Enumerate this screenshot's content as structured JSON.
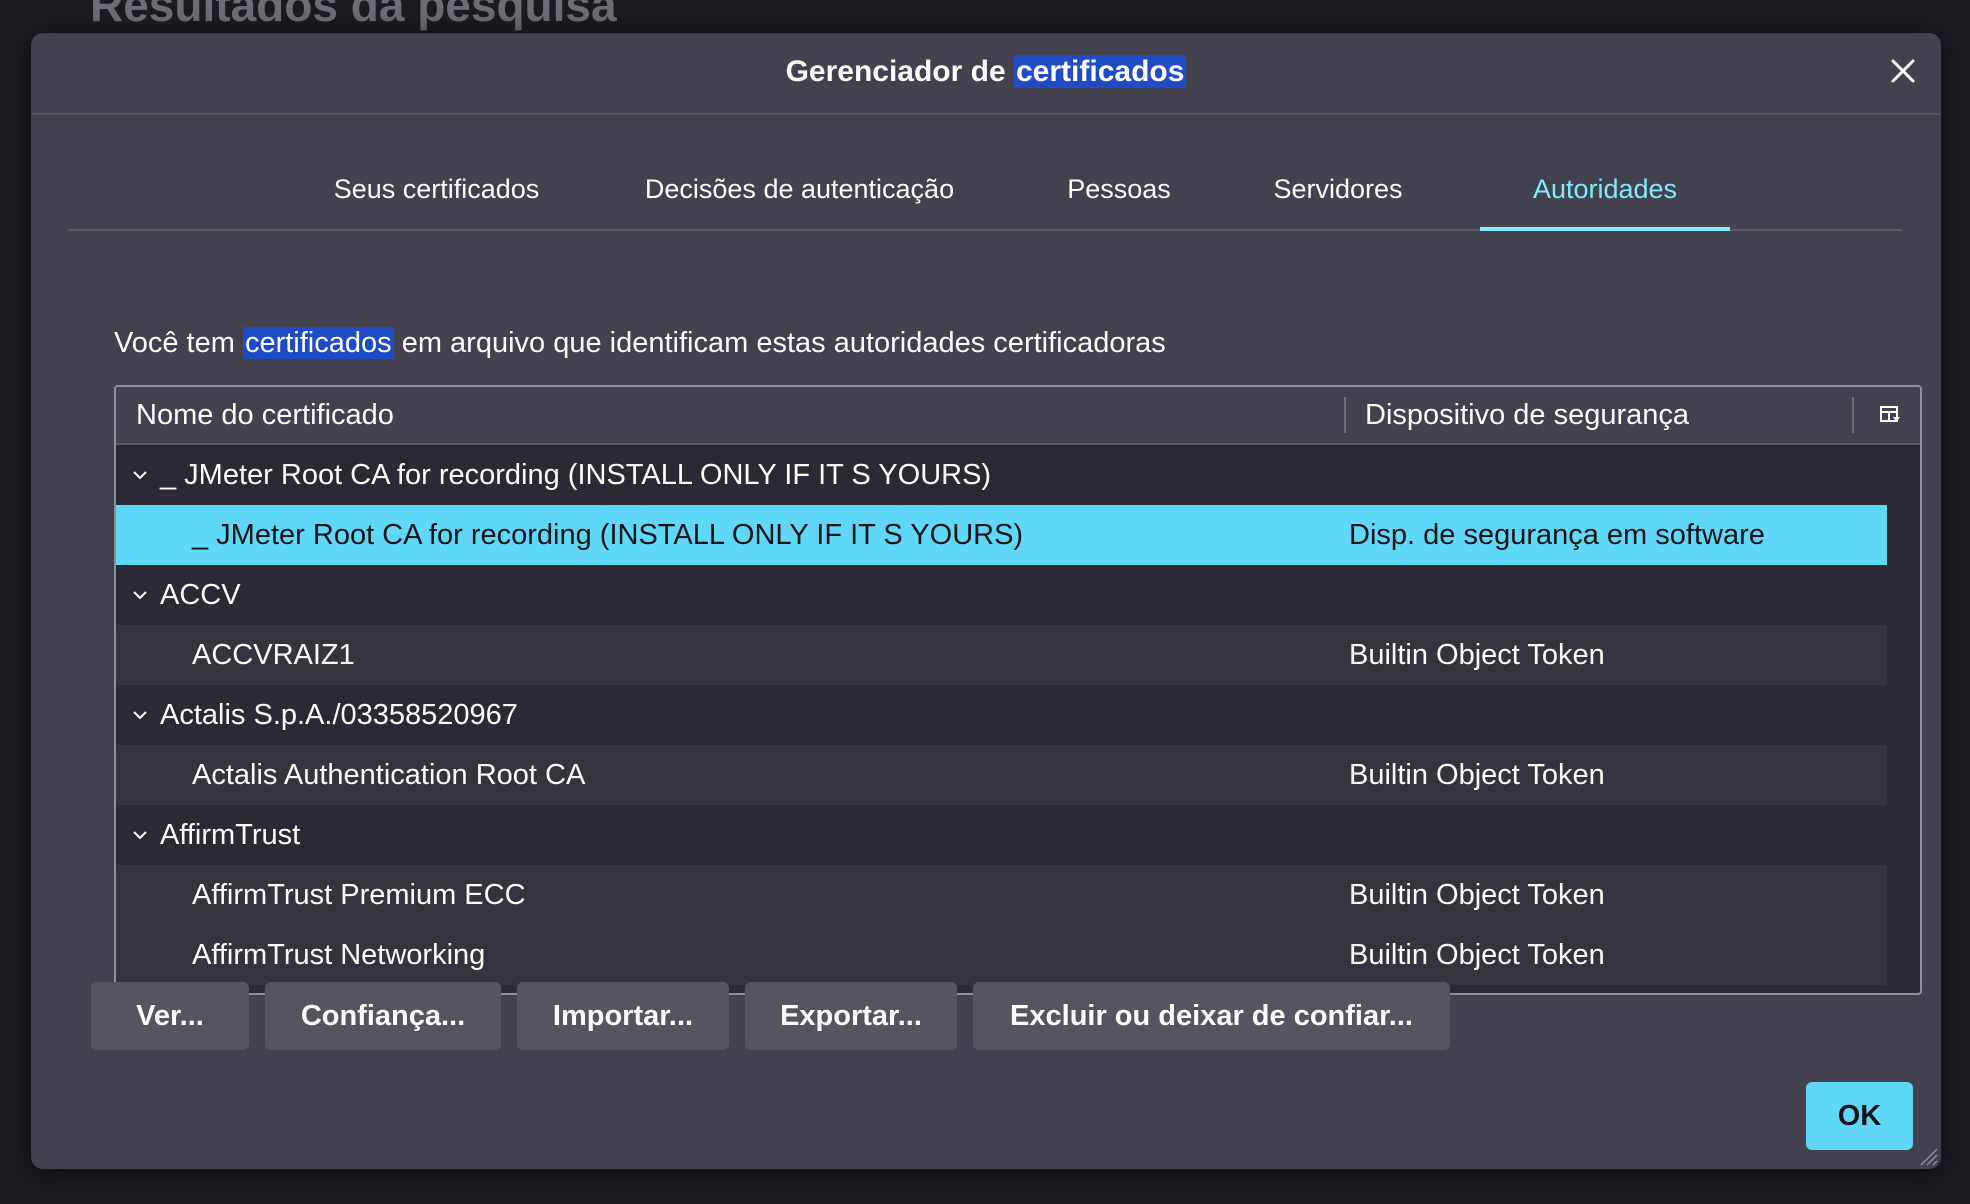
{
  "background": {
    "heading": "Resultados da pesquisa"
  },
  "dialog": {
    "title_prefix": "Gerenciador de ",
    "title_highlight": "certificados",
    "tabs": [
      {
        "label": "Seus certificados",
        "active": false
      },
      {
        "label": "Decisões de autenticação",
        "active": false
      },
      {
        "label": "Pessoas",
        "active": false
      },
      {
        "label": "Servidores",
        "active": false
      },
      {
        "label": "Autoridades",
        "active": true
      }
    ],
    "description": {
      "prefix": "Você tem ",
      "highlight": "certificados",
      "suffix": " em arquivo que identificam estas autoridades certificadoras"
    },
    "tree": {
      "columns": {
        "name": "Nome do certificado",
        "device": "Dispositivo de segurança"
      },
      "rows": [
        {
          "type": "group",
          "name": "_ JMeter Root CA for recording (INSTALL ONLY IF IT S YOURS)",
          "device": ""
        },
        {
          "type": "leaf",
          "name": "_ JMeter Root CA for recording (INSTALL ONLY IF IT S YOURS)",
          "device": "Disp. de segurança em software",
          "selected": true
        },
        {
          "type": "group",
          "name": "ACCV",
          "device": ""
        },
        {
          "type": "leaf",
          "name": "ACCVRAIZ1",
          "device": "Builtin Object Token"
        },
        {
          "type": "group",
          "name": "Actalis S.p.A./03358520967",
          "device": ""
        },
        {
          "type": "leaf",
          "name": "Actalis Authentication Root CA",
          "device": "Builtin Object Token"
        },
        {
          "type": "group",
          "name": "AffirmTrust",
          "device": ""
        },
        {
          "type": "leaf",
          "name": "AffirmTrust Premium ECC",
          "device": "Builtin Object Token"
        },
        {
          "type": "leaf",
          "name": "AffirmTrust Networking",
          "device": "Builtin Object Token"
        }
      ]
    },
    "buttons": {
      "view": "Ver...",
      "trust": "Confiança...",
      "import": "Importar...",
      "export": "Exportar...",
      "delete": "Excluir ou deixar de confiar..."
    },
    "ok": "OK"
  },
  "colors": {
    "accent": "#80ebff",
    "selection": "#5fd8f8",
    "find_highlight": "#1f4cc6",
    "dialog_bg": "#42414d"
  }
}
